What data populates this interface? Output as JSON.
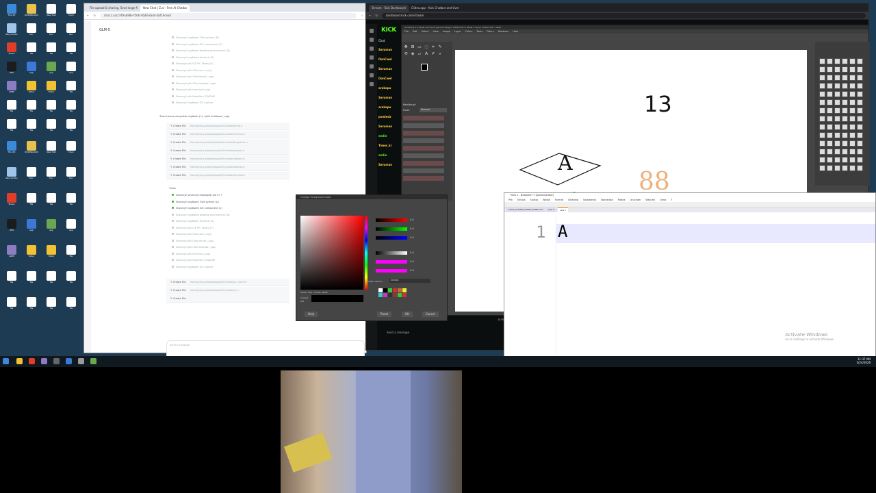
{
  "desktop": {
    "icons": [
      {
        "label": "This PC",
        "color": "#3b8ad9"
      },
      {
        "label": "DOWNLOADS",
        "color": "#e8c24a"
      },
      {
        "label": "New Text",
        "color": "#ffffff"
      },
      {
        "label": "Docs",
        "color": "#ffffff"
      },
      {
        "label": "Recycle Bin",
        "color": "#9fc5e8"
      },
      {
        "label": "Doc",
        "color": "#ffffff"
      },
      {
        "label": "Doc",
        "color": "#ffffff"
      },
      {
        "label": "Doc",
        "color": "#ffffff"
      },
      {
        "label": "Brave",
        "color": "#e23d28"
      },
      {
        "label": "file",
        "color": "#ffffff"
      },
      {
        "label": "file",
        "color": "#ffffff"
      },
      {
        "label": "file",
        "color": "#ffffff"
      },
      {
        "label": "OBS",
        "color": "#1c1c1c"
      },
      {
        "label": "app",
        "color": "#3c78d8"
      },
      {
        "label": "app",
        "color": "#6aa84f"
      },
      {
        "label": "app",
        "color": "#ffffff"
      },
      {
        "label": "GIMP",
        "color": "#8e7cc3"
      },
      {
        "label": "folder",
        "color": "#f1c232"
      },
      {
        "label": "folder",
        "color": "#f1c232"
      },
      {
        "label": "file",
        "color": "#ffffff"
      },
      {
        "label": "file",
        "color": "#ffffff"
      },
      {
        "label": "file",
        "color": "#ffffff"
      },
      {
        "label": "file",
        "color": "#ffffff"
      },
      {
        "label": "file",
        "color": "#ffffff"
      },
      {
        "label": "file",
        "color": "#ffffff"
      },
      {
        "label": "file",
        "color": "#ffffff"
      },
      {
        "label": "file",
        "color": "#ffffff"
      },
      {
        "label": "file",
        "color": "#ffffff"
      }
    ]
  },
  "chat_browser": {
    "tabs": [
      "File upload & sharing. Send large fi",
      "New Chat | Z.ai - Free AI Chatbo",
      "Stream - Kick Dashboard",
      "Clideo.app - Kick Chatbot and Over"
    ],
    "url": "chat.z.ai/c/749ab98e-f566-46d8-8add-bbf19cea6",
    "model": "GLM-5",
    "tasks_top": [
      "Stworzyć nagłówek Ollie system (B)",
      "Stworzyć nagłówek ICE component (C)",
      "Stworzyć nagłówek desktop environment (D)",
      "Stworzyć nagłówek terminal (E)",
      "Stworzyć plik ICE IPC library (F)",
      "Stworzyć plik Ollie core (.cpp)",
      "Stworzyć plik Ollie Kernel (.cpp)",
      "Stworzyć plik Ollie desktop (.cpp)",
      "Stworzyć plik terminal (.cpp)",
      "Stworzyć plik Makefile / README",
      "Stworzyć nagłówek ICE system"
    ],
    "section_heading": "Teraz tworzę wszystkie nagłówki (.h) i pliki źródłowe (.cpp)",
    "files": [
      {
        "label": "Create File",
        "path": "/home/z/my-project/os/ollie/include/kernel.h"
      },
      {
        "label": "Create File",
        "path": "/home/z/my-project/os/ollie/include/memory.h"
      },
      {
        "label": "Create File",
        "path": "/home/z/my-project/os/ollie/include/filesystem.h"
      },
      {
        "label": "Create File",
        "path": "/home/z/my-project/os/ollie/include/process.h"
      },
      {
        "label": "Create File",
        "path": "/home/z/my-project/os/ollie/include/network.h"
      },
      {
        "label": "Create File",
        "path": "/home/z/my-project/os/ollie/include/desktop.h"
      },
      {
        "label": "Create File",
        "path": "/home/z/my-project/os/ollie/include/terminal.h"
      }
    ],
    "todos_label": "Todos",
    "tasks_bottom": [
      {
        "text": "Utworzyć strukturę katalogów dla C++",
        "done": true
      },
      {
        "text": "Stworzyć nagłówek Ollie system (A)",
        "done": true
      },
      {
        "text": "Stworzyć nagłówek ICE component (C)",
        "done": true
      },
      {
        "text": "Stworzyć nagłówek desktop environment (D)",
        "done": false
      },
      {
        "text": "Stworzyć nagłówek terminal (E)",
        "done": false
      },
      {
        "text": "Stworzyć plik ICE IPC library (F)",
        "done": false
      },
      {
        "text": "Stworzyć plik Ollie core (.cpp)",
        "done": false
      },
      {
        "text": "Stworzyć plik Ollie kernel (.cpp)",
        "done": false
      },
      {
        "text": "Stworzyć plik Ollie desktop (.cpp)",
        "done": false
      },
      {
        "text": "Stworzyć plik terminal (.cpp)",
        "done": false
      },
      {
        "text": "Stworzyć plik Makefile / README",
        "done": false
      },
      {
        "text": "Stworzyć nagłówek ICE system",
        "done": false
      }
    ],
    "files2": [
      {
        "label": "Create File",
        "path": "/home/z/my-project/os/ollie/include/ipc_client.h"
      },
      {
        "label": "Create File",
        "path": "/home/z/my-project/os/ollie/include/ice.h"
      },
      {
        "label": "Create File",
        "path": ""
      }
    ],
    "input_placeholder": "Send a message"
  },
  "kick": {
    "url": "dashboard.kick.com/stream",
    "logo": "KICK",
    "chat_heading": "Chat",
    "messages": [
      {
        "user": "Saruman",
        "green": false
      },
      {
        "user": "DonCwel",
        "green": false
      },
      {
        "user": "Saruman",
        "green": false
      },
      {
        "user": "DonCwel",
        "green": false
      },
      {
        "user": "arakapu",
        "green": false
      },
      {
        "user": "Saruman",
        "green": false
      },
      {
        "user": "arakapu",
        "green": false
      },
      {
        "user": "powiedz",
        "green": false
      },
      {
        "user": "Saruman",
        "green": false
      },
      {
        "user": "emlie",
        "green": true
      },
      {
        "user": "Timer_ki",
        "green": false
      },
      {
        "user": "emlie",
        "green": true
      },
      {
        "user": "Saruman",
        "green": false
      }
    ],
    "send_placeholder": "Send a message"
  },
  "gimp": {
    "title": "[Untitled]-3.0 (RGB color 8-bit gamma integer, GIMP built-in sRGB, 1 layer) 1645x1126 - GIMP",
    "menu": [
      "File",
      "Edit",
      "Select",
      "View",
      "Image",
      "Layer",
      "Colors",
      "Tools",
      "Filters",
      "Windows",
      "Help"
    ],
    "tool_options_label": "Paintbrush",
    "mode_label": "Mode",
    "mode_value": "Normal",
    "canvas_number": "13",
    "canvas_letter_big": "A",
    "canvas_letter_small": "A",
    "canvas_orange_text": "88",
    "zoom": "157%"
  },
  "color_dialog": {
    "title": "Change Foreground Color",
    "values": [
      "0.0",
      "0.0",
      "0.0",
      "0.0",
      "0.0",
      "0.0"
    ],
    "model_label": "Model: HSV - Profile: sRGB",
    "html_label": "HTML notation",
    "html_value": "000000",
    "current_label": "Current",
    "old_label": "Old",
    "buttons": {
      "help": "Help",
      "reset": "Reset",
      "ok": "OK",
      "cancel": "Cancel"
    },
    "swatches": [
      "#ffffff",
      "#000000",
      "#3c3",
      "#c33",
      "#c63",
      "#ee3",
      "#3cc",
      "#c3c",
      "#333",
      "#933",
      "#3c3",
      "#c33"
    ]
  },
  "notepad": {
    "title": "*new 1 - Notepad++ [Administrator]",
    "menu": [
      "Plik",
      "Edycja",
      "Szukaj",
      "Widok",
      "Format",
      "Składnia",
      "Ustawienia",
      "Narzędzia",
      "Makra",
      "Uruchom",
      "Wtyczki",
      "Okna",
      "?"
    ],
    "tabs": [
      "TITLE_SYSTEM_SCRIPT_PANEL.txt",
      "new 2",
      "new 1"
    ],
    "line_number": "1",
    "content": "A",
    "watermark_title": "Activate Windows",
    "watermark_sub": "Go to Settings to activate Windows."
  },
  "taskbar": {
    "time": "11:37 AM",
    "date": "5/24/2026"
  }
}
